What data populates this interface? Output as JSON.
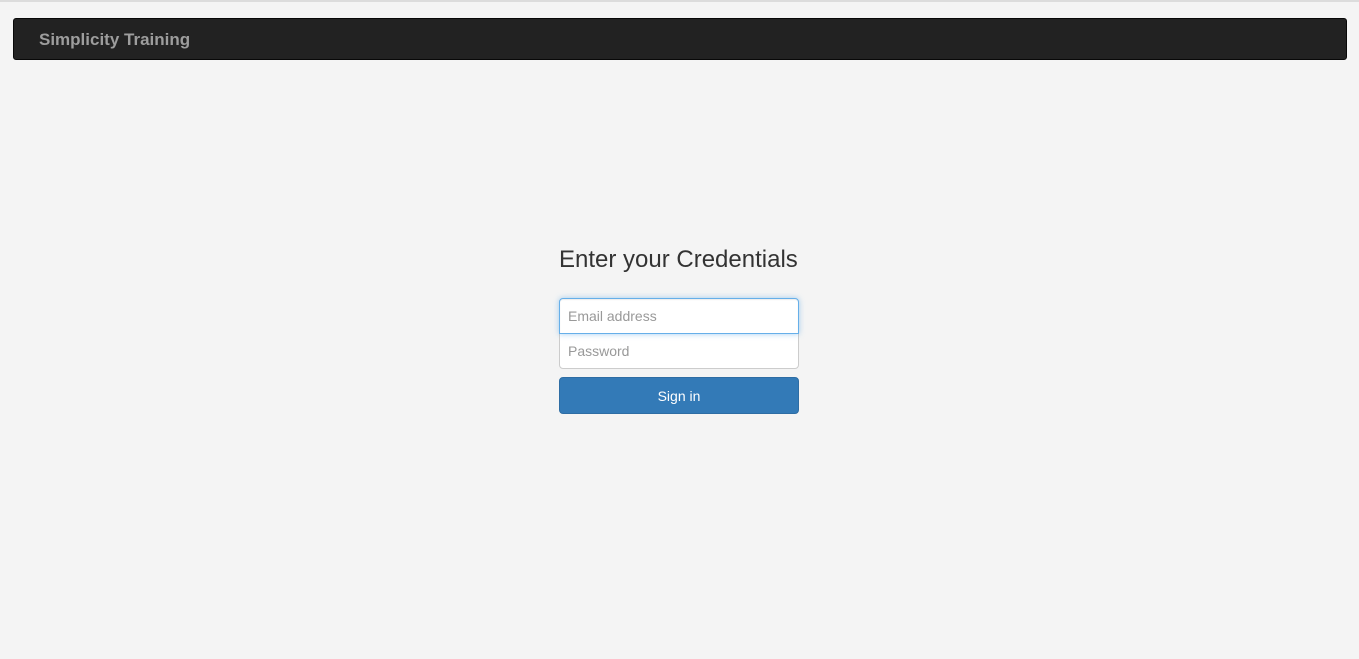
{
  "navbar": {
    "brand": "Simplicity Training"
  },
  "login": {
    "heading": "Enter your Credentials",
    "email_placeholder": "Email address",
    "email_value": "",
    "password_placeholder": "Password",
    "password_value": "",
    "submit_label": "Sign in"
  },
  "colors": {
    "navbar_bg": "#222222",
    "brand_text": "#9d9d9d",
    "page_bg": "#f4f4f4",
    "primary_button": "#337ab7",
    "focus_border": "#66afe9"
  }
}
